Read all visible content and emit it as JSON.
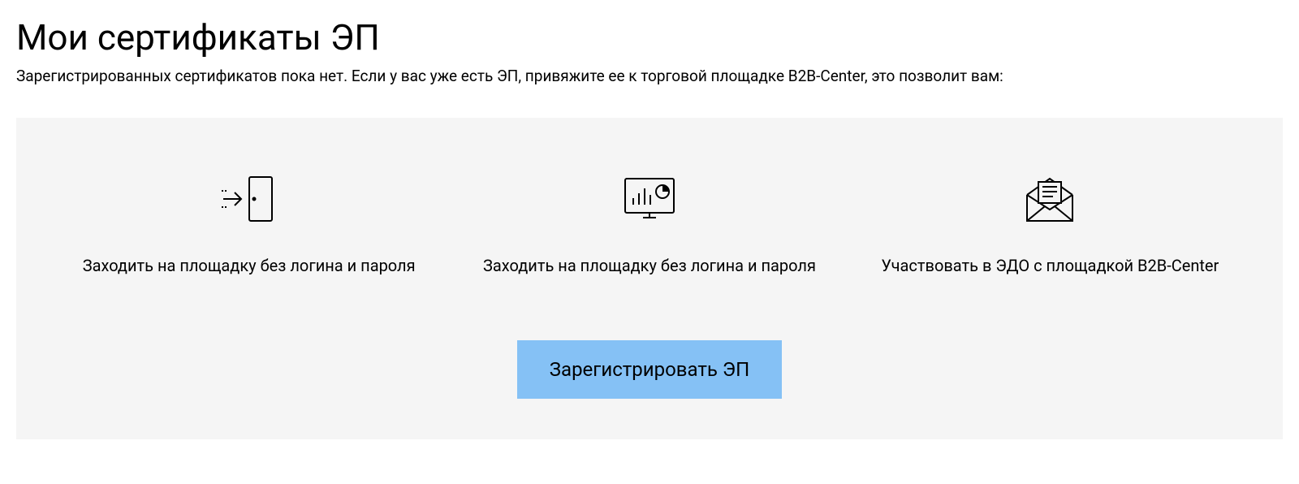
{
  "page": {
    "title": "Мои сертификаты ЭП",
    "subtitle": "Зарегистрированных сертификатов пока нет. Если у вас уже есть ЭП, привяжите ее к торговой площадке B2B-Center, это позволит вам:"
  },
  "features": [
    {
      "icon": "login-door-icon",
      "text": "Заходить на площадку без логина и пароля"
    },
    {
      "icon": "analytics-monitor-icon",
      "text": "Заходить на площадку без логина и пароля"
    },
    {
      "icon": "envelope-document-icon",
      "text": "Участвовать в ЭДО с площадкой B2B-Center"
    }
  ],
  "cta": {
    "label": "Зарегистрировать ЭП"
  }
}
